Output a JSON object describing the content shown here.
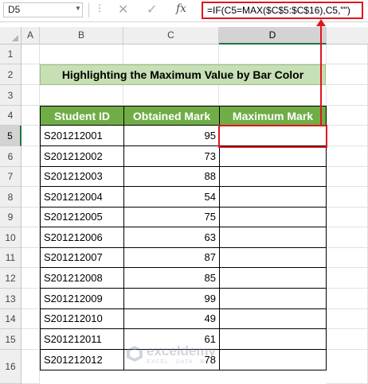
{
  "formula_bar": {
    "name_box": "D5",
    "cancel_icon": "✕",
    "enter_icon": "✓",
    "fx_label": "fx",
    "formula": "=IF(C5=MAX($C$5:$C$16),C5,\"\")"
  },
  "columns": [
    "A",
    "B",
    "C",
    "D"
  ],
  "rows": [
    "1",
    "2",
    "3",
    "4",
    "5",
    "6",
    "7",
    "8",
    "9",
    "10",
    "11",
    "12",
    "13",
    "14",
    "15",
    "16"
  ],
  "title": "Highlighting the Maximum Value by Bar Color",
  "table": {
    "headers": [
      "Student ID",
      "Obtained Mark",
      "Maximum Mark"
    ],
    "rows": [
      {
        "id": "S201212001",
        "mark": "95",
        "max": ""
      },
      {
        "id": "S201212002",
        "mark": "73",
        "max": ""
      },
      {
        "id": "S201212003",
        "mark": "88",
        "max": ""
      },
      {
        "id": "S201212004",
        "mark": "54",
        "max": ""
      },
      {
        "id": "S201212005",
        "mark": "75",
        "max": ""
      },
      {
        "id": "S201212006",
        "mark": "63",
        "max": ""
      },
      {
        "id": "S201212007",
        "mark": "87",
        "max": ""
      },
      {
        "id": "S201212008",
        "mark": "85",
        "max": ""
      },
      {
        "id": "S201212009",
        "mark": "99",
        "max": ""
      },
      {
        "id": "S201212010",
        "mark": "49",
        "max": ""
      },
      {
        "id": "S201212011",
        "mark": "61",
        "max": ""
      },
      {
        "id": "S201212012",
        "mark": "78",
        "max": ""
      }
    ]
  },
  "selected_cell": "D5",
  "colors": {
    "header_fill": "#70ad47",
    "title_fill": "#c6dfb4",
    "highlight": "#e0161c"
  },
  "watermark": {
    "name": "exceldemy",
    "tagline": "EXCEL · DATA · BI"
  }
}
